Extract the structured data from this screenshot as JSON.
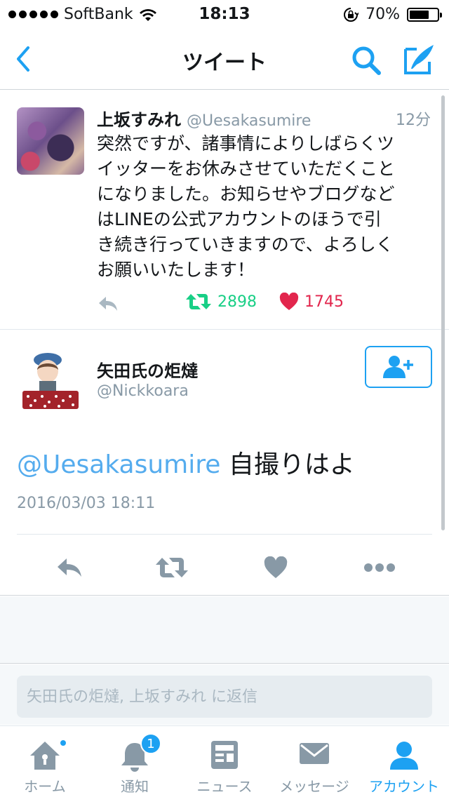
{
  "status_bar": {
    "carrier": "SoftBank",
    "time": "18:13",
    "battery_percent": "70%",
    "battery_level": 0.7
  },
  "nav": {
    "title": "ツイート",
    "icons": [
      "back-chevron-icon",
      "search-icon",
      "compose-tweet-icon"
    ],
    "accent_color": "#1da1f2"
  },
  "parent_tweet": {
    "name": "上坂すみれ",
    "handle": "@Uesakasumire",
    "time": "12分",
    "text": "突然ですが、諸事情によりしばらくツ\nイッターをお休みさせていただくこと\nになりました。お知らせやブログなど\nはLINEの公式アカウントのほうで引\nき続き行っていきますので、よろしく\nお願いいたします！",
    "retweets": "2898",
    "likes": "1745",
    "retweet_color": "#19cf86",
    "like_color": "#e2264d"
  },
  "focused_tweet": {
    "name": "矢田氏の炬燵",
    "handle": "@Nickkoara",
    "mention": "@Uesakasumire",
    "text": " 自撮りはよ",
    "date": "2016/03/03 18:11",
    "icons": [
      "reply-icon",
      "retweet-icon",
      "like-icon",
      "more-icon",
      "follow-user-icon"
    ]
  },
  "reply_bar": {
    "placeholder": "矢田氏の炬燵, 上坂すみれ に返信"
  },
  "tab_bar": {
    "items": [
      {
        "label": "ホーム",
        "icon": "home-icon"
      },
      {
        "label": "通知",
        "icon": "bell-icon",
        "badge": "1"
      },
      {
        "label": "ニュース",
        "icon": "news-icon"
      },
      {
        "label": "メッセージ",
        "icon": "envelope-icon"
      },
      {
        "label": "アカウント",
        "icon": "account-icon",
        "active": true
      }
    ]
  }
}
